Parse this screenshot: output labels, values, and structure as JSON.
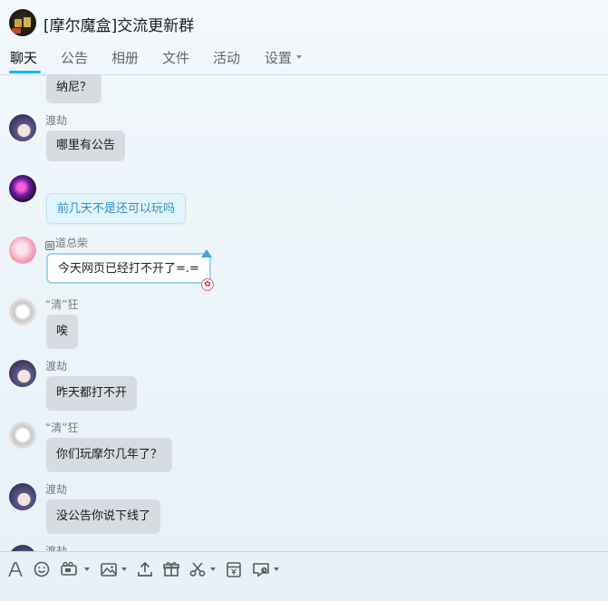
{
  "header": {
    "group_title": "[摩尔魔盒]交流更新群"
  },
  "tabs": [
    {
      "label": "聊天",
      "active": true
    },
    {
      "label": "公告"
    },
    {
      "label": "相册"
    },
    {
      "label": "文件"
    },
    {
      "label": "活动"
    },
    {
      "label": "设置"
    }
  ],
  "messages": [
    {
      "sender": "",
      "text": "纳尼？"
    },
    {
      "sender": "渡劫",
      "text": "哪里有公告"
    },
    {
      "sender": "",
      "text": "前几天不是还可以玩吗"
    },
    {
      "sender": "道总柴",
      "text": "今天网页已经打不开了=.="
    },
    {
      "sender": "“清”狂",
      "text": "唉"
    },
    {
      "sender": "渡劫",
      "text": "昨天都打不开"
    },
    {
      "sender": "“清”狂",
      "text": "你们玩摩尔几年了？"
    },
    {
      "sender": "渡劫",
      "text": "没公告你说下线了"
    },
    {
      "sender": "渡劫",
      "text": ""
    }
  ],
  "toolbar": {
    "icons": [
      "font-icon",
      "emoji-icon",
      "gif-icon",
      "image-icon",
      "upload-icon",
      "gift-icon",
      "scissors-icon",
      "red-packet-icon",
      "chat-record-icon"
    ]
  },
  "colors": {
    "accent": "#12b7f5",
    "bubble": "#d6dce2",
    "blue_bubble_text": "#2f8fc2"
  }
}
